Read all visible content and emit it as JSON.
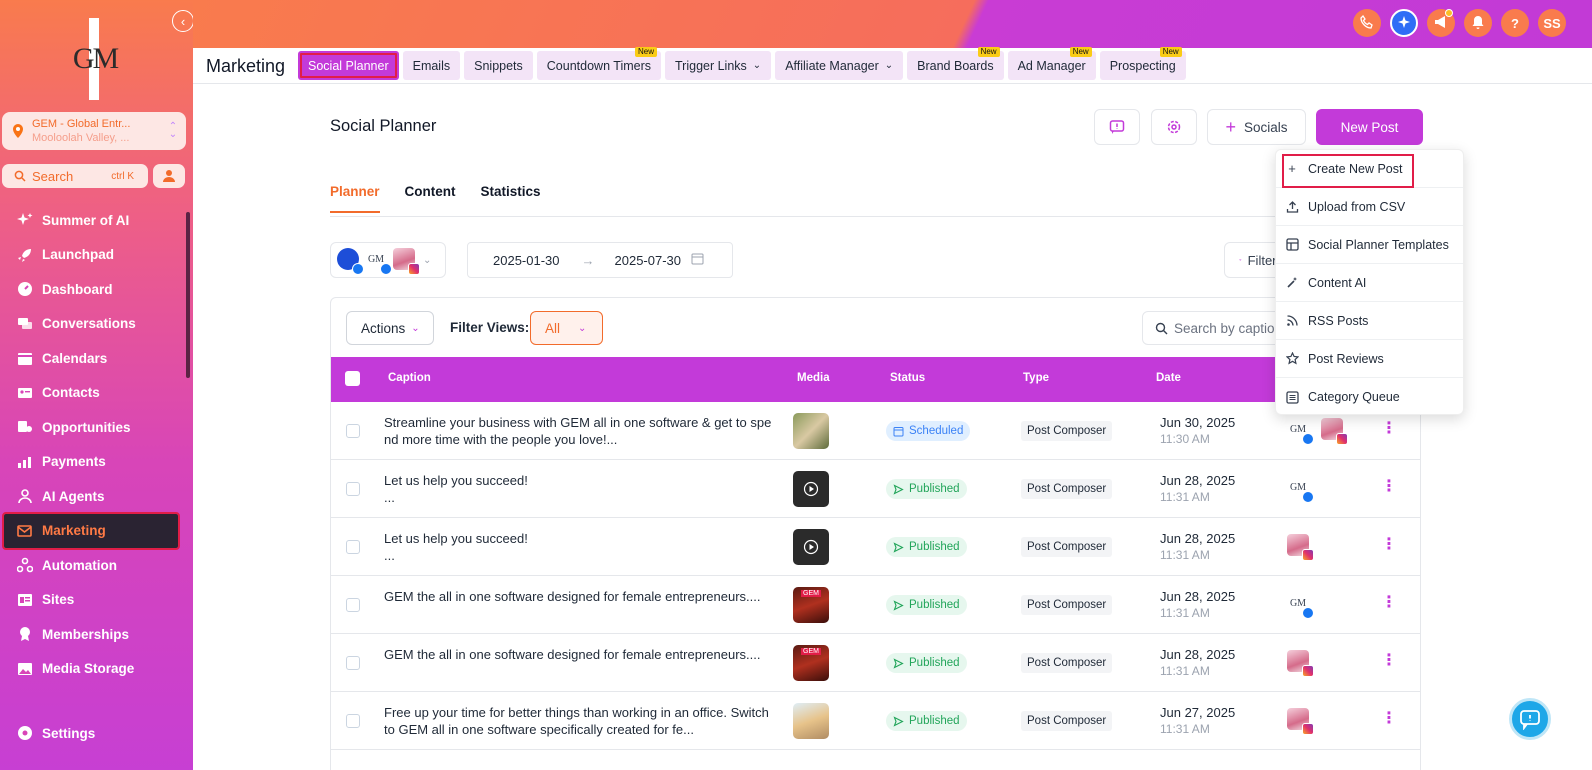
{
  "sidebar": {
    "logo_text": "GM",
    "location": {
      "name": "GEM - Global Entr...",
      "sub": "Mooloolah Valley, ..."
    },
    "search": {
      "placeholder": "Search",
      "shortcut": "ctrl K"
    },
    "nav": [
      {
        "label": "Summer of AI",
        "icon": "sparkles-icon"
      },
      {
        "label": "Launchpad",
        "icon": "rocket-icon"
      },
      {
        "label": "Dashboard",
        "icon": "gauge-icon"
      },
      {
        "label": "Conversations",
        "icon": "chat-icon"
      },
      {
        "label": "Calendars",
        "icon": "calendar-icon"
      },
      {
        "label": "Contacts",
        "icon": "contact-card-icon"
      },
      {
        "label": "Opportunities",
        "icon": "funnel-icon"
      },
      {
        "label": "Payments",
        "icon": "chart-up-icon"
      },
      {
        "label": "AI Agents",
        "icon": "robot-icon"
      },
      {
        "label": "Marketing",
        "icon": "mail-check-icon",
        "active": true
      },
      {
        "label": "Automation",
        "icon": "workflow-icon"
      },
      {
        "label": "Sites",
        "icon": "sites-icon"
      },
      {
        "label": "Memberships",
        "icon": "badge-icon"
      },
      {
        "label": "Media Storage",
        "icon": "image-icon"
      }
    ],
    "settings_label": "Settings"
  },
  "topbar": {
    "avatar_initials": "SS",
    "help_label": "?"
  },
  "tabstrip": {
    "module_title": "Marketing",
    "tabs": [
      {
        "label": "Social Planner",
        "active": true
      },
      {
        "label": "Emails"
      },
      {
        "label": "Snippets"
      },
      {
        "label": "Countdown Timers",
        "badge": "New"
      },
      {
        "label": "Trigger Links",
        "dropdown": true
      },
      {
        "label": "Affiliate Manager",
        "dropdown": true
      },
      {
        "label": "Brand Boards",
        "badge": "New"
      },
      {
        "label": "Ad Manager",
        "badge": "New"
      },
      {
        "label": "Prospecting",
        "badge": "New"
      }
    ]
  },
  "page": {
    "title": "Social Planner",
    "socials_label": "Socials",
    "new_post_label": "New Post",
    "subtabs": [
      "Planner",
      "Content",
      "Statistics"
    ],
    "date_start": "2025-01-30",
    "date_end": "2025-07-30",
    "filter_label": "Filters",
    "actions_label": "Actions",
    "filter_views_label": "Filter Views:",
    "filter_views_value": "All",
    "search_placeholder": "Search by caption"
  },
  "dropdown": {
    "items": [
      {
        "label": "Create New Post",
        "icon": "plus-icon"
      },
      {
        "label": "Upload from CSV",
        "icon": "upload-icon"
      },
      {
        "label": "Social Planner Templates",
        "icon": "template-icon"
      },
      {
        "label": "Content AI",
        "icon": "magic-wand-icon"
      },
      {
        "label": "RSS Posts",
        "icon": "rss-icon"
      },
      {
        "label": "Post Reviews",
        "icon": "star-icon"
      },
      {
        "label": "Category Queue",
        "icon": "list-icon"
      }
    ]
  },
  "table": {
    "headers": {
      "caption": "Caption",
      "media": "Media",
      "status": "Status",
      "type": "Type",
      "date": "Date"
    },
    "rows": [
      {
        "caption": "Streamline your business with GEM all in one software & get to spend more time with the people you love!...",
        "media": "photo",
        "status": "Scheduled",
        "type": "Post Composer",
        "date": "Jun 30, 2025",
        "time": "11:30 AM",
        "accounts": [
          "gm-fb",
          "photo-ig"
        ]
      },
      {
        "caption": "Let us help you succeed!\n...",
        "media": "video",
        "status": "Published",
        "type": "Post Composer",
        "date": "Jun 28, 2025",
        "time": "11:31 AM",
        "accounts": [
          "gm-fb"
        ]
      },
      {
        "caption": "Let us help you succeed!\n...",
        "media": "video",
        "status": "Published",
        "type": "Post Composer",
        "date": "Jun 28, 2025",
        "time": "11:31 AM",
        "accounts": [
          "photo-ig"
        ]
      },
      {
        "caption": "GEM the all in one software designed for female entrepreneurs....",
        "media": "gem",
        "status": "Published",
        "type": "Post Composer",
        "date": "Jun 28, 2025",
        "time": "11:31 AM",
        "accounts": [
          "gm-fb"
        ]
      },
      {
        "caption": "GEM the all in one software designed for female entrepreneurs....",
        "media": "gem",
        "status": "Published",
        "type": "Post Composer",
        "date": "Jun 28, 2025",
        "time": "11:31 AM",
        "accounts": [
          "photo-ig"
        ]
      },
      {
        "caption": "Free up your time for better things than working in an office. Switch to GEM all in one software specifically created for fe...",
        "media": "portrait",
        "status": "Published",
        "type": "Post Composer",
        "date": "Jun 27, 2025",
        "time": "11:31 AM",
        "accounts": [
          "photo-ig"
        ]
      }
    ]
  },
  "colors": {
    "brand": "#c33ad9",
    "accent": "#f26b2b",
    "highlight": "#e11d48"
  }
}
